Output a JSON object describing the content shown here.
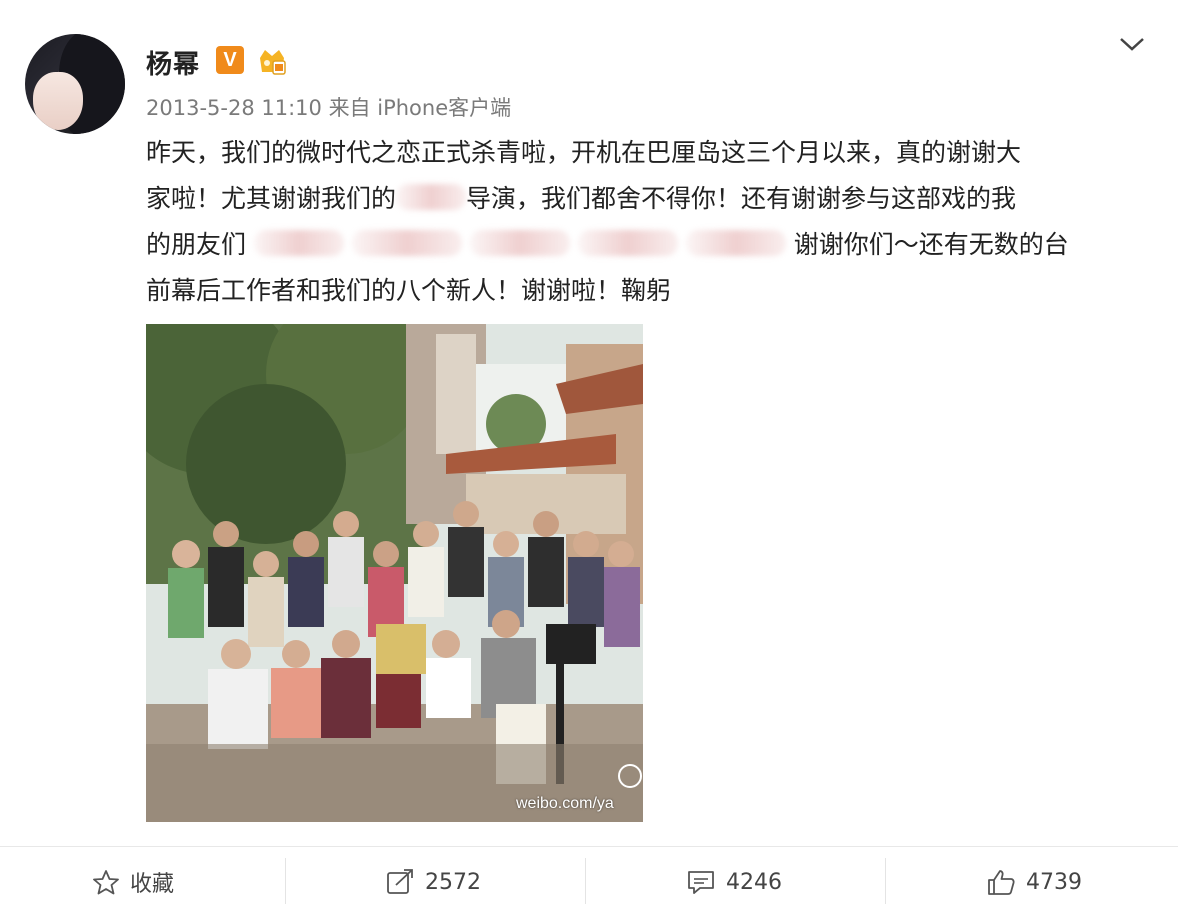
{
  "user": {
    "name": "杨幂",
    "vip_label": "V"
  },
  "post": {
    "timestamp": "2013-5-28 11:10",
    "source": "来自 iPhone客户端",
    "line1": "昨天，我们的微时代之恋正式杀青啦，开机在巴厘岛这三个月以来，真的谢谢大",
    "line2a": "家啦！尤其谢谢我们的",
    "line2b": "导演，我们都舍不得你！还有谢谢参与这部戏的我",
    "line3a": "的朋友们",
    "line3b": "谢谢你们～还有无数的台",
    "line4": "前幕后工作者和我们的八个新人！谢谢啦！鞠躬",
    "image_watermark": "weibo.com/ya"
  },
  "actions": {
    "favorite_label": "收藏",
    "repost_count": "2572",
    "comment_count": "4246",
    "like_count": "4739"
  },
  "icons": [
    "star-icon",
    "repost-icon",
    "comment-icon",
    "thumbs-up-icon",
    "chevron-down-icon",
    "member-crown-icon"
  ],
  "colors": {
    "vip_orange": "#f08a1a",
    "meta_gray": "#7a7a7a"
  }
}
